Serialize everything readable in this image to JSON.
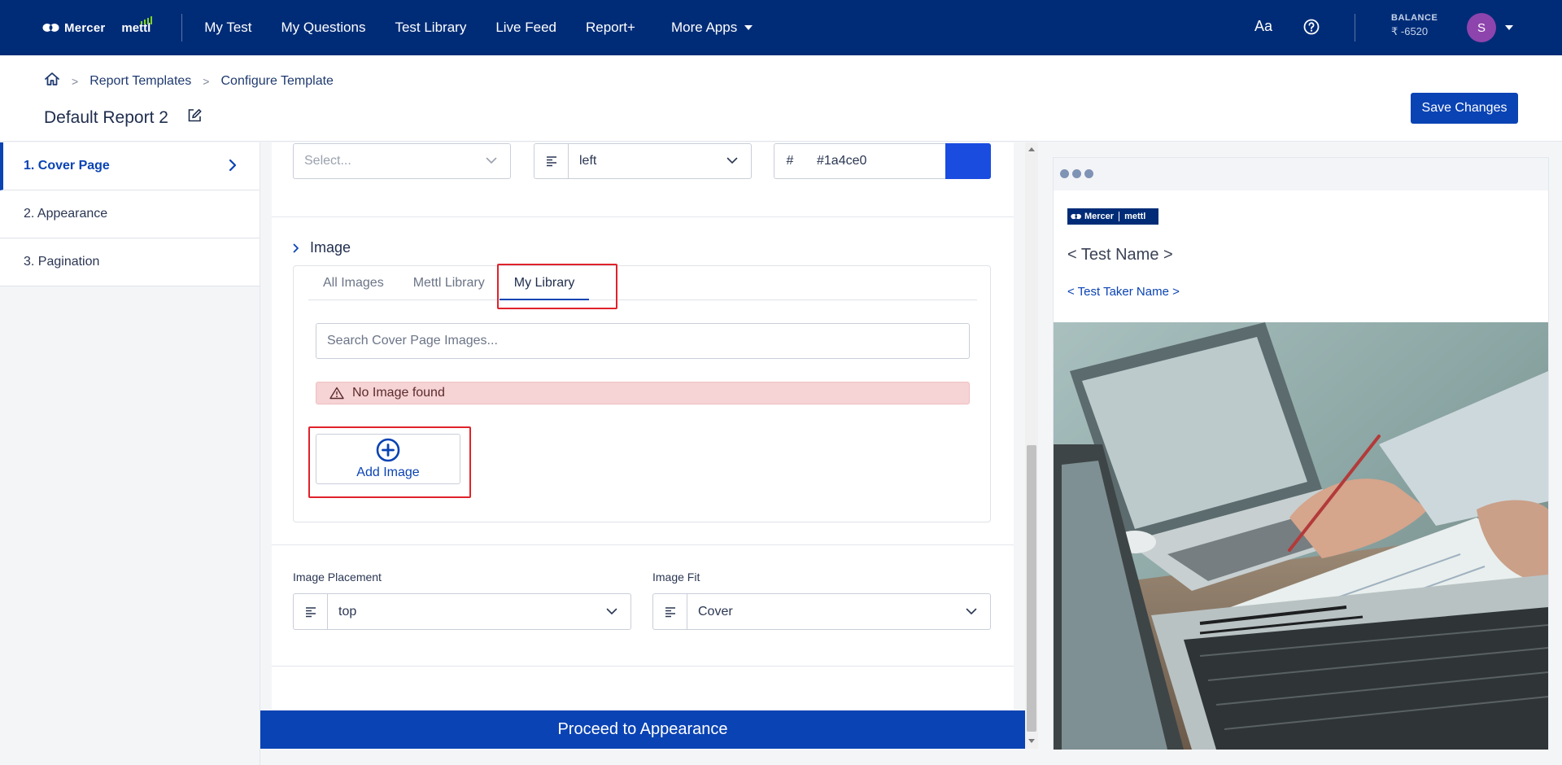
{
  "topnav": {
    "brand_mercer": "Mercer",
    "brand_mettl": "mettl",
    "links": [
      "My Test",
      "My Questions",
      "Test Library",
      "Live Feed",
      "Report+"
    ],
    "more_apps": "More Apps",
    "font_toggle": "Aa",
    "balance_label": "BALANCE",
    "balance_value": "₹ -6520",
    "avatar_initial": "S"
  },
  "breadcrumb": {
    "items": [
      "Report Templates",
      "Configure Template"
    ],
    "separator": ">"
  },
  "page": {
    "title": "Default Report 2",
    "save_label": "Save Changes"
  },
  "sidebar": {
    "items": [
      {
        "label": "1. Cover Page",
        "active": true
      },
      {
        "label": "2. Appearance",
        "active": false
      },
      {
        "label": "3. Pagination",
        "active": false
      }
    ]
  },
  "text_row": {
    "font_placeholder": "Select...",
    "align_value": "left",
    "color_hash": "#",
    "color_value": "#1a4ce0",
    "swatch_color": "#1a4ce0"
  },
  "image_section": {
    "title": "Image",
    "tabs": [
      "All Images",
      "Mettl Library",
      "My Library"
    ],
    "active_tab": "My Library",
    "search_placeholder": "Search Cover Page Images...",
    "alert_text": "No Image found",
    "add_label": "Add Image"
  },
  "placement": {
    "placement_label": "Image Placement",
    "placement_value": "top",
    "fit_label": "Image Fit",
    "fit_value": "Cover"
  },
  "proceed_label": "Proceed to Appearance",
  "preview": {
    "logo_mercer": "Mercer",
    "logo_mettl": "mettl",
    "test_name": "< Test Name >",
    "taker_name": "< Test Taker Name >"
  },
  "colors": {
    "nav_bg": "#002c77",
    "primary": "#0a43b4",
    "highlight": "#e0222b",
    "alert_bg": "#f6d3d4"
  }
}
